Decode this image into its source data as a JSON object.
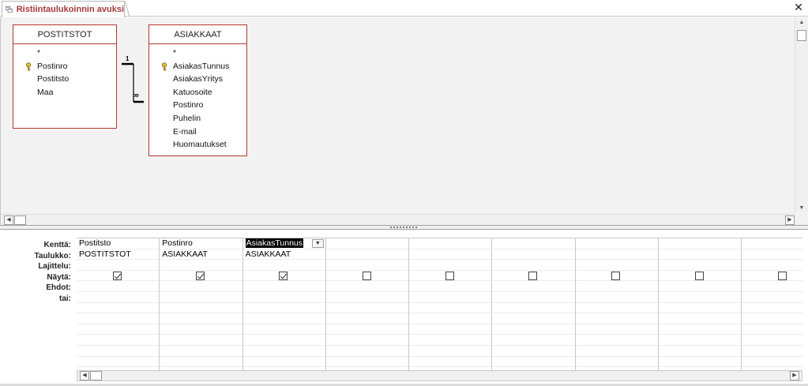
{
  "tab": {
    "title": "Ristiintaulukoinnin avuksi",
    "icon": "query-icon"
  },
  "window": {
    "close_glyph": "✕"
  },
  "tables": [
    {
      "name": "POSTITSTOT",
      "fields": [
        "*",
        "Postinro",
        "Postitsto",
        "Maa"
      ],
      "key_field_index": 1
    },
    {
      "name": "ASIAKKAAT",
      "fields": [
        "*",
        "AsiakasTunnus",
        "AsiakasYritys",
        "Katuosoite",
        "Postinro",
        "Puhelin",
        "E-mail",
        "Huomautukset"
      ],
      "key_field_index": 1
    }
  ],
  "relationship": {
    "one_side": "1",
    "many_side": "∞"
  },
  "grid": {
    "row_labels": [
      "Kenttä:",
      "Taulukko:",
      "Lajittelu:",
      "Näytä:",
      "Ehdot:",
      "tai:"
    ],
    "columns": [
      {
        "field": "Postitsto",
        "table": "POSTITSTOT",
        "show": true
      },
      {
        "field": "Postinro",
        "table": "ASIAKKAAT",
        "show": true
      },
      {
        "field": "AsiakasTunnus",
        "table": "ASIAKKAAT",
        "show": true,
        "selected": true
      },
      {
        "field": "",
        "table": "",
        "show": false
      },
      {
        "field": "",
        "table": "",
        "show": false
      },
      {
        "field": "",
        "table": "",
        "show": false
      },
      {
        "field": "",
        "table": "",
        "show": false
      },
      {
        "field": "",
        "table": "",
        "show": false
      },
      {
        "field": "",
        "table": "",
        "show": false
      }
    ]
  },
  "colors": {
    "accent": "#a4373a",
    "table_border": "#b03a2e"
  }
}
